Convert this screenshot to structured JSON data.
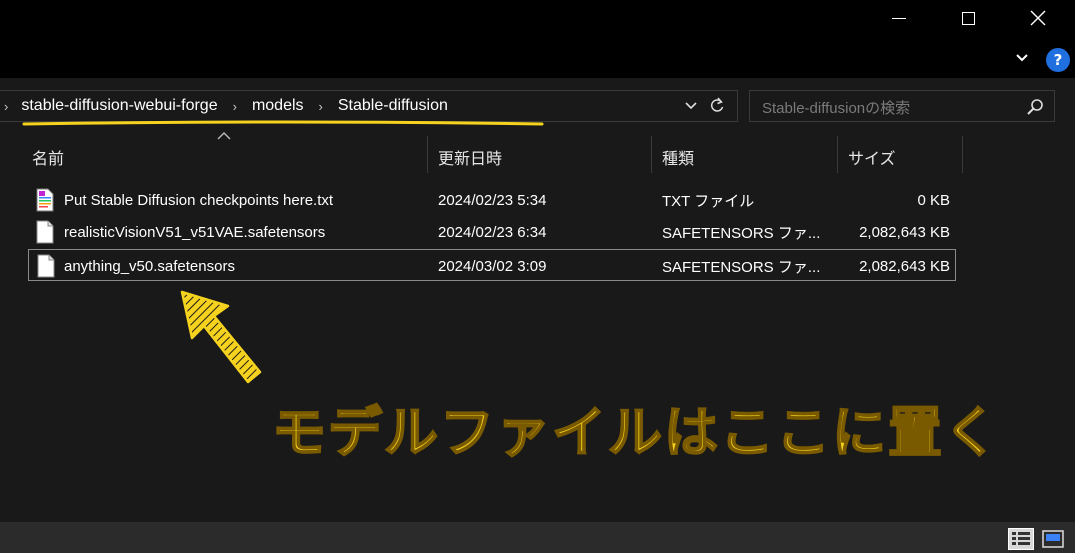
{
  "window": {
    "minimize_icon": "minimize-icon",
    "maximize_icon": "maximize-icon",
    "close_icon": "close-icon",
    "close_glyph": "✕"
  },
  "ribbon": {
    "help_label": "?"
  },
  "address": {
    "crumbs": [
      "stable-diffusion-webui-forge",
      "models",
      "Stable-diffusion"
    ],
    "separator": "›"
  },
  "search": {
    "placeholder": "Stable-diffusionの検索"
  },
  "columns": {
    "name": "名前",
    "date": "更新日時",
    "type": "種類",
    "size": "サイズ"
  },
  "files": [
    {
      "name": "Put Stable Diffusion checkpoints here.txt",
      "date": "2024/02/23 5:34",
      "type": "TXT ファイル",
      "size": "0 KB",
      "icon": "text-file-icon"
    },
    {
      "name": "realisticVisionV51_v51VAE.safetensors",
      "date": "2024/02/23 6:34",
      "type": "SAFETENSORS ファ...",
      "size": "2,082,643 KB",
      "icon": "blank-file-icon"
    },
    {
      "name": "anything_v50.safetensors",
      "date": "2024/03/02 3:09",
      "type": "SAFETENSORS ファ...",
      "size": "2,082,643 KB",
      "icon": "blank-file-icon"
    }
  ],
  "annotation": {
    "text": "モデルファイルはここに置く",
    "color": "#f5d21e"
  },
  "colors": {
    "background": "#191919",
    "titlebar": "#000000",
    "accent": "#1f6fe0"
  }
}
